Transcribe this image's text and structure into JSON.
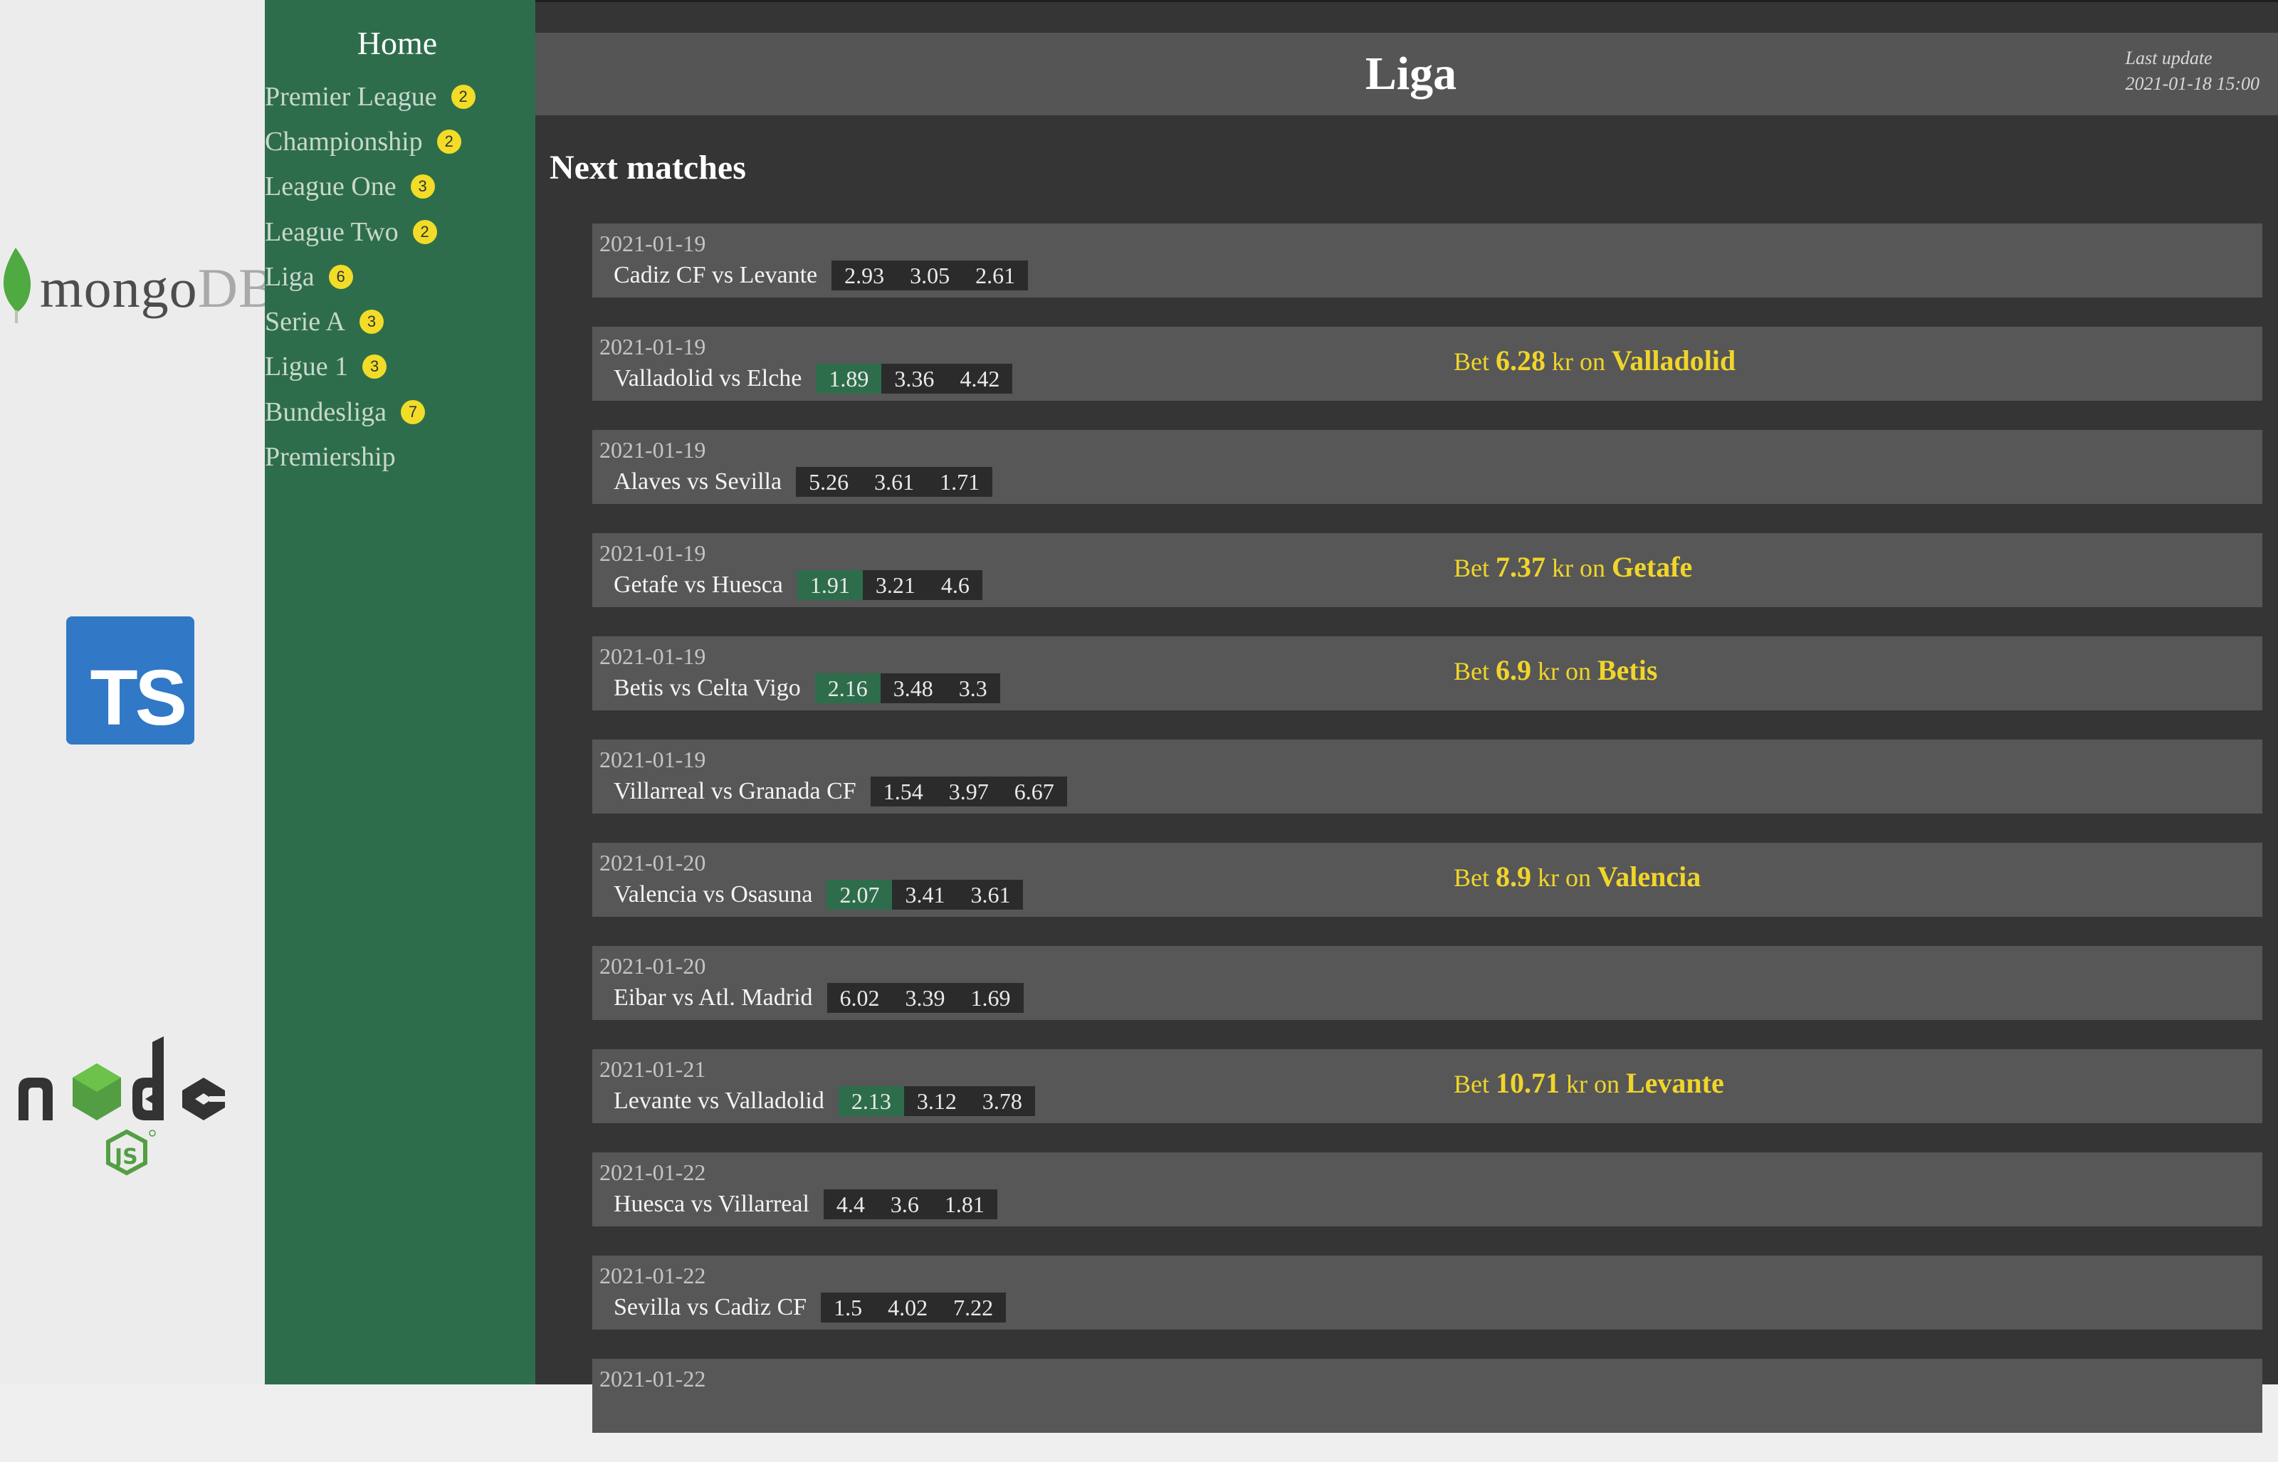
{
  "colors": {
    "sidebar": "#2e6d4c",
    "badge": "#f2dc27",
    "main_bg": "#353535",
    "card_bg": "#575757",
    "bet_text": "#f0d52a"
  },
  "logos": {
    "mongo_word": "mongo",
    "mongo_db": "DB.",
    "ts": "TS",
    "node_icon": "nodejs-logo-icon",
    "mongo_icon": "mongodb-leaf-icon"
  },
  "sidebar": {
    "home": "Home",
    "items": [
      {
        "label": "Premier League",
        "badge": "2"
      },
      {
        "label": "Championship",
        "badge": "2"
      },
      {
        "label": "League One",
        "badge": "3"
      },
      {
        "label": "League Two",
        "badge": "2"
      },
      {
        "label": "Liga",
        "badge": "6"
      },
      {
        "label": "Serie A",
        "badge": "3"
      },
      {
        "label": "Ligue 1",
        "badge": "3"
      },
      {
        "label": "Bundesliga",
        "badge": "7"
      },
      {
        "label": "Premiership",
        "badge": ""
      }
    ]
  },
  "header": {
    "title": "Liga",
    "last_update_label": "Last update",
    "last_update": "2021-01-18 15:00"
  },
  "section_title": "Next matches",
  "matches": [
    {
      "date": "2021-01-19",
      "teams": "Cadiz CF vs Levante",
      "odds": [
        "2.93",
        "3.05",
        "2.61"
      ],
      "highlight": -1,
      "bet": null
    },
    {
      "date": "2021-01-19",
      "teams": "Valladolid vs Elche",
      "odds": [
        "1.89",
        "3.36",
        "4.42"
      ],
      "highlight": 0,
      "bet": {
        "amount": "6.28",
        "team": "Valladolid"
      }
    },
    {
      "date": "2021-01-19",
      "teams": "Alaves vs Sevilla",
      "odds": [
        "5.26",
        "3.61",
        "1.71"
      ],
      "highlight": -1,
      "bet": null
    },
    {
      "date": "2021-01-19",
      "teams": "Getafe vs Huesca",
      "odds": [
        "1.91",
        "3.21",
        "4.6"
      ],
      "highlight": 0,
      "bet": {
        "amount": "7.37",
        "team": "Getafe"
      }
    },
    {
      "date": "2021-01-19",
      "teams": "Betis vs Celta Vigo",
      "odds": [
        "2.16",
        "3.48",
        "3.3"
      ],
      "highlight": 0,
      "bet": {
        "amount": "6.9",
        "team": "Betis"
      }
    },
    {
      "date": "2021-01-19",
      "teams": "Villarreal vs Granada CF",
      "odds": [
        "1.54",
        "3.97",
        "6.67"
      ],
      "highlight": -1,
      "bet": null
    },
    {
      "date": "2021-01-20",
      "teams": "Valencia vs Osasuna",
      "odds": [
        "2.07",
        "3.41",
        "3.61"
      ],
      "highlight": 0,
      "bet": {
        "amount": "8.9",
        "team": "Valencia"
      }
    },
    {
      "date": "2021-01-20",
      "teams": "Eibar vs Atl. Madrid",
      "odds": [
        "6.02",
        "3.39",
        "1.69"
      ],
      "highlight": -1,
      "bet": null
    },
    {
      "date": "2021-01-21",
      "teams": "Levante vs Valladolid",
      "odds": [
        "2.13",
        "3.12",
        "3.78"
      ],
      "highlight": 0,
      "bet": {
        "amount": "10.71",
        "team": "Levante"
      }
    },
    {
      "date": "2021-01-22",
      "teams": "Huesca vs Villarreal",
      "odds": [
        "4.4",
        "3.6",
        "1.81"
      ],
      "highlight": -1,
      "bet": null
    },
    {
      "date": "2021-01-22",
      "teams": "Sevilla vs Cadiz CF",
      "odds": [
        "1.5",
        "4.02",
        "7.22"
      ],
      "highlight": -1,
      "bet": null
    },
    {
      "date": "2021-01-22",
      "teams": "",
      "odds": [],
      "highlight": -1,
      "bet": null
    }
  ],
  "bet_words": {
    "prefix": "Bet",
    "currency": "kr on"
  }
}
